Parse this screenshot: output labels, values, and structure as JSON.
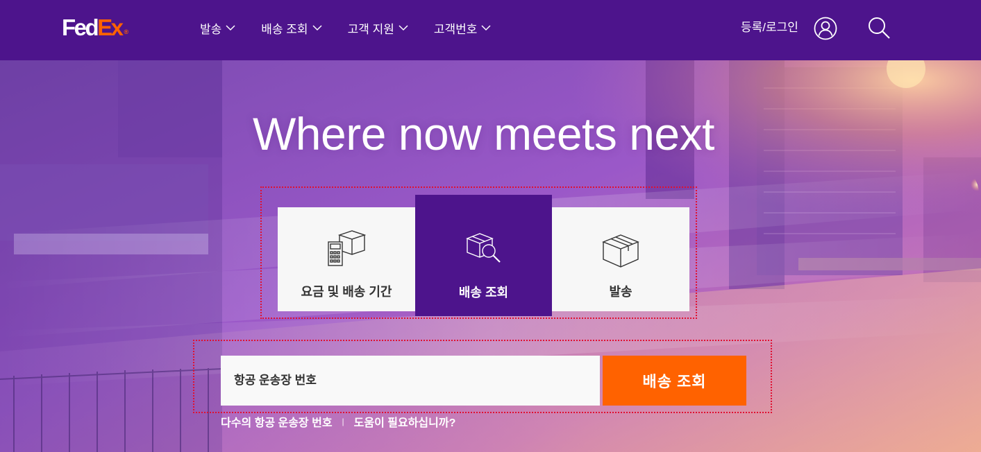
{
  "brand": {
    "name_fed": "Fed",
    "name_ex": "Ex",
    "mark": "®"
  },
  "nav": {
    "items": [
      {
        "label": "발송"
      },
      {
        "label": "배송 조회"
      },
      {
        "label": "고객 지원"
      },
      {
        "label": "고객번호"
      }
    ],
    "login_label": "등록/로그인"
  },
  "hero": {
    "headline": "Where now meets next",
    "tabs": [
      {
        "label": "요금 및 배송 기간",
        "icon": "calculator-box-icon"
      },
      {
        "label": "배송 조회",
        "icon": "box-magnifier-icon",
        "active": true
      },
      {
        "label": "발송",
        "icon": "package-icon"
      }
    ],
    "tracking": {
      "placeholder": "항공 운송장 번호",
      "button_label": "배송 조회"
    },
    "links": {
      "multiple": "다수의 항공 운송장 번호",
      "separator": "|",
      "help": "도움이 필요하십니까?"
    }
  },
  "colors": {
    "brand_purple": "#4d148c",
    "brand_orange": "#ff6200",
    "annotation_red": "#e01030"
  }
}
